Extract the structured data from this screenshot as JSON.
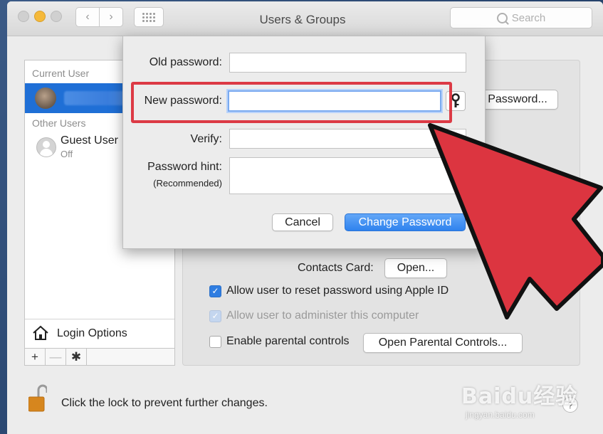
{
  "window": {
    "title": "Users & Groups"
  },
  "toolbar": {
    "search_placeholder": "Search"
  },
  "sidebar": {
    "current_user_label": "Current User",
    "other_users_label": "Other Users",
    "guest_user": {
      "name": "Guest User",
      "status": "Off"
    },
    "login_options_label": "Login Options",
    "add_symbol": "+",
    "remove_symbol": "—",
    "gear_symbol": "✱"
  },
  "main": {
    "change_password_button": "Password...",
    "contacts_card_label": "Contacts Card:",
    "open_button": "Open...",
    "allow_reset_label": "Allow user to reset password using Apple ID",
    "allow_reset_checked": true,
    "allow_admin_label": "Allow user to administer this computer",
    "allow_admin_checked": true,
    "parental_controls_label": "Enable parental controls",
    "parental_controls_checked": false,
    "open_parental_button": "Open Parental Controls..."
  },
  "sheet": {
    "old_password_label": "Old password:",
    "new_password_label": "New password:",
    "verify_label": "Verify:",
    "hint_label": "Password hint:",
    "hint_sub_label": "(Recommended)",
    "cancel_button": "Cancel",
    "change_button": "Change Password"
  },
  "footer": {
    "lock_text": "Click the lock to prevent further changes.",
    "help_symbol": "?"
  },
  "overlay": {
    "watermark": "Baidu经验",
    "watermark_sub": "jingyan.baidu.com",
    "highlight_color": "#dc3a45",
    "arrow_color": "#dc3540"
  }
}
